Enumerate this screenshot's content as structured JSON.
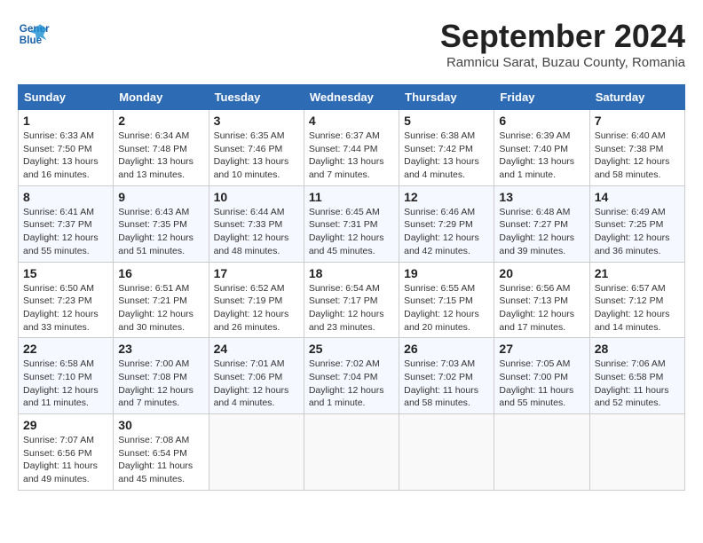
{
  "header": {
    "logo_line1": "General",
    "logo_line2": "Blue",
    "month": "September 2024",
    "location": "Ramnicu Sarat, Buzau County, Romania"
  },
  "days_of_week": [
    "Sunday",
    "Monday",
    "Tuesday",
    "Wednesday",
    "Thursday",
    "Friday",
    "Saturday"
  ],
  "weeks": [
    [
      {
        "day": 1,
        "info": "Sunrise: 6:33 AM\nSunset: 7:50 PM\nDaylight: 13 hours\nand 16 minutes."
      },
      {
        "day": 2,
        "info": "Sunrise: 6:34 AM\nSunset: 7:48 PM\nDaylight: 13 hours\nand 13 minutes."
      },
      {
        "day": 3,
        "info": "Sunrise: 6:35 AM\nSunset: 7:46 PM\nDaylight: 13 hours\nand 10 minutes."
      },
      {
        "day": 4,
        "info": "Sunrise: 6:37 AM\nSunset: 7:44 PM\nDaylight: 13 hours\nand 7 minutes."
      },
      {
        "day": 5,
        "info": "Sunrise: 6:38 AM\nSunset: 7:42 PM\nDaylight: 13 hours\nand 4 minutes."
      },
      {
        "day": 6,
        "info": "Sunrise: 6:39 AM\nSunset: 7:40 PM\nDaylight: 13 hours\nand 1 minute."
      },
      {
        "day": 7,
        "info": "Sunrise: 6:40 AM\nSunset: 7:38 PM\nDaylight: 12 hours\nand 58 minutes."
      }
    ],
    [
      {
        "day": 8,
        "info": "Sunrise: 6:41 AM\nSunset: 7:37 PM\nDaylight: 12 hours\nand 55 minutes."
      },
      {
        "day": 9,
        "info": "Sunrise: 6:43 AM\nSunset: 7:35 PM\nDaylight: 12 hours\nand 51 minutes."
      },
      {
        "day": 10,
        "info": "Sunrise: 6:44 AM\nSunset: 7:33 PM\nDaylight: 12 hours\nand 48 minutes."
      },
      {
        "day": 11,
        "info": "Sunrise: 6:45 AM\nSunset: 7:31 PM\nDaylight: 12 hours\nand 45 minutes."
      },
      {
        "day": 12,
        "info": "Sunrise: 6:46 AM\nSunset: 7:29 PM\nDaylight: 12 hours\nand 42 minutes."
      },
      {
        "day": 13,
        "info": "Sunrise: 6:48 AM\nSunset: 7:27 PM\nDaylight: 12 hours\nand 39 minutes."
      },
      {
        "day": 14,
        "info": "Sunrise: 6:49 AM\nSunset: 7:25 PM\nDaylight: 12 hours\nand 36 minutes."
      }
    ],
    [
      {
        "day": 15,
        "info": "Sunrise: 6:50 AM\nSunset: 7:23 PM\nDaylight: 12 hours\nand 33 minutes."
      },
      {
        "day": 16,
        "info": "Sunrise: 6:51 AM\nSunset: 7:21 PM\nDaylight: 12 hours\nand 30 minutes."
      },
      {
        "day": 17,
        "info": "Sunrise: 6:52 AM\nSunset: 7:19 PM\nDaylight: 12 hours\nand 26 minutes."
      },
      {
        "day": 18,
        "info": "Sunrise: 6:54 AM\nSunset: 7:17 PM\nDaylight: 12 hours\nand 23 minutes."
      },
      {
        "day": 19,
        "info": "Sunrise: 6:55 AM\nSunset: 7:15 PM\nDaylight: 12 hours\nand 20 minutes."
      },
      {
        "day": 20,
        "info": "Sunrise: 6:56 AM\nSunset: 7:13 PM\nDaylight: 12 hours\nand 17 minutes."
      },
      {
        "day": 21,
        "info": "Sunrise: 6:57 AM\nSunset: 7:12 PM\nDaylight: 12 hours\nand 14 minutes."
      }
    ],
    [
      {
        "day": 22,
        "info": "Sunrise: 6:58 AM\nSunset: 7:10 PM\nDaylight: 12 hours\nand 11 minutes."
      },
      {
        "day": 23,
        "info": "Sunrise: 7:00 AM\nSunset: 7:08 PM\nDaylight: 12 hours\nand 7 minutes."
      },
      {
        "day": 24,
        "info": "Sunrise: 7:01 AM\nSunset: 7:06 PM\nDaylight: 12 hours\nand 4 minutes."
      },
      {
        "day": 25,
        "info": "Sunrise: 7:02 AM\nSunset: 7:04 PM\nDaylight: 12 hours\nand 1 minute."
      },
      {
        "day": 26,
        "info": "Sunrise: 7:03 AM\nSunset: 7:02 PM\nDaylight: 11 hours\nand 58 minutes."
      },
      {
        "day": 27,
        "info": "Sunrise: 7:05 AM\nSunset: 7:00 PM\nDaylight: 11 hours\nand 55 minutes."
      },
      {
        "day": 28,
        "info": "Sunrise: 7:06 AM\nSunset: 6:58 PM\nDaylight: 11 hours\nand 52 minutes."
      }
    ],
    [
      {
        "day": 29,
        "info": "Sunrise: 7:07 AM\nSunset: 6:56 PM\nDaylight: 11 hours\nand 49 minutes."
      },
      {
        "day": 30,
        "info": "Sunrise: 7:08 AM\nSunset: 6:54 PM\nDaylight: 11 hours\nand 45 minutes."
      },
      null,
      null,
      null,
      null,
      null
    ]
  ]
}
